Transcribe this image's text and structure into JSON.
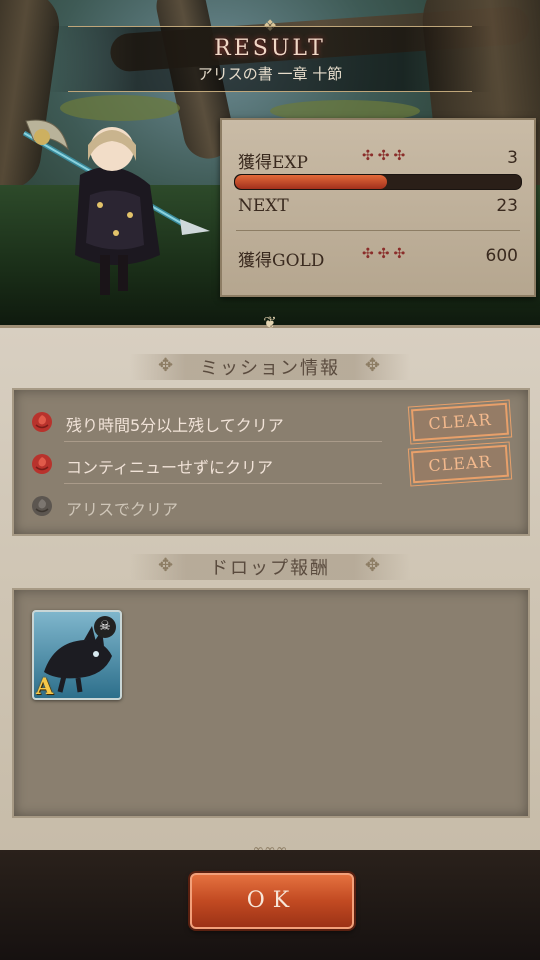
{
  "header": {
    "title": "RESULT",
    "stage": "アリスの書 一章 十節"
  },
  "stats": {
    "exp_label": "獲得EXP",
    "exp_dots": "✣✣✣",
    "exp_value": "3",
    "exp_progress": 0.53,
    "next_label": "NEXT",
    "next_value": "23",
    "gold_label": "獲得GOLD",
    "gold_dots": "✣✣✣",
    "gold_value": "600"
  },
  "missions": {
    "heading": "ミッション情報",
    "items": [
      {
        "label": "残り時間5分以上残してクリア",
        "status": "CLEAR",
        "completed": true
      },
      {
        "label": "コンティニューせずにクリア",
        "status": "CLEAR",
        "completed": true
      },
      {
        "label": "アリスでクリア",
        "status": "",
        "completed": false
      }
    ]
  },
  "drops": {
    "heading": "ドロップ報酬",
    "items": [
      {
        "icon": "black-wolf-weapon-icon",
        "rank": "A"
      }
    ]
  },
  "actions": {
    "ok_label": "OK"
  },
  "colors": {
    "accent": "#c24a22",
    "exp_fill": "#e36a3a",
    "clear_stamp": "#e8a06a",
    "rose_active": "#b8322c",
    "rose_inactive": "#5c5650"
  }
}
